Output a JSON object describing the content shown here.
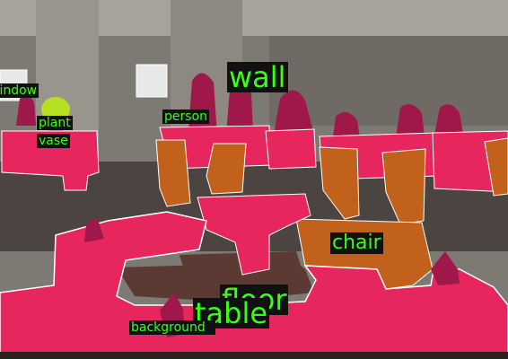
{
  "image": {
    "description_colors": {
      "wall": "#8f8a82",
      "table": "#e8265e",
      "chair": "#c2611c",
      "person": "#a0174a",
      "floor": "#5a3a32",
      "plant": "#b6e021",
      "window": "#e8e8e8",
      "label_text": "#39ff14",
      "label_bg": "#111111"
    }
  },
  "labels": {
    "wall": "wall",
    "window": "window",
    "plant": "plant",
    "vase": "vase",
    "person": "person",
    "chair": "chair",
    "floor": "floor",
    "table": "table",
    "background": "background"
  }
}
